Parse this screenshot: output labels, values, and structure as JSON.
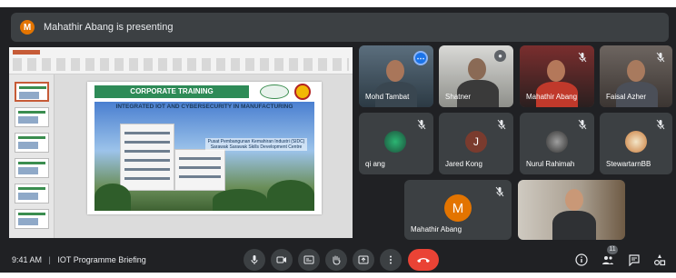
{
  "banner": {
    "avatar_letter": "M",
    "text": "Mahathir Abang is presenting"
  },
  "presentation": {
    "slide_header": "CORPORATE TRAINING",
    "slide_subtitle": "INTEGRATED IOT AND CYBERSECURITY IN MANUFACTURING",
    "slide_caption": "Pusat Pembangunan Kemahiran Industri (SIDC) Sarawak Sarawak Skills Development Centre"
  },
  "participants": [
    {
      "name": "Mohd Tambat",
      "type": "video"
    },
    {
      "name": "Shatner",
      "type": "video"
    },
    {
      "name": "Mahathir Abang",
      "type": "video"
    },
    {
      "name": "Faisal Azher",
      "type": "video"
    },
    {
      "name": "qi ang",
      "type": "avatar-photo"
    },
    {
      "name": "Jared Kong",
      "type": "avatar",
      "letter": "J"
    },
    {
      "name": "Nurul Rahimah",
      "type": "avatar-photo"
    },
    {
      "name": "StewartarnBB",
      "type": "avatar-photo"
    },
    {
      "name": "Mahathir Abang",
      "type": "avatar",
      "letter": "M"
    },
    {
      "name": "",
      "type": "video"
    }
  ],
  "footer": {
    "time": "9:41 AM",
    "separator": "|",
    "meeting_title": "IOT Programme Briefing",
    "people_count": "11"
  },
  "colors": {
    "background": "#202124",
    "tile": "#3c4043",
    "end_call": "#ea4335",
    "avatar_orange": "#e37400",
    "avatar_brown": "#7a3b2e",
    "accent_blue": "#8ab4f8"
  },
  "icons": {
    "controls": [
      "mic-icon",
      "camera-icon",
      "captions-icon",
      "raise-hand-icon",
      "present-icon",
      "more-options-icon",
      "end-call-icon"
    ],
    "right": [
      "info-icon",
      "people-icon",
      "chat-icon",
      "activities-icon"
    ]
  }
}
